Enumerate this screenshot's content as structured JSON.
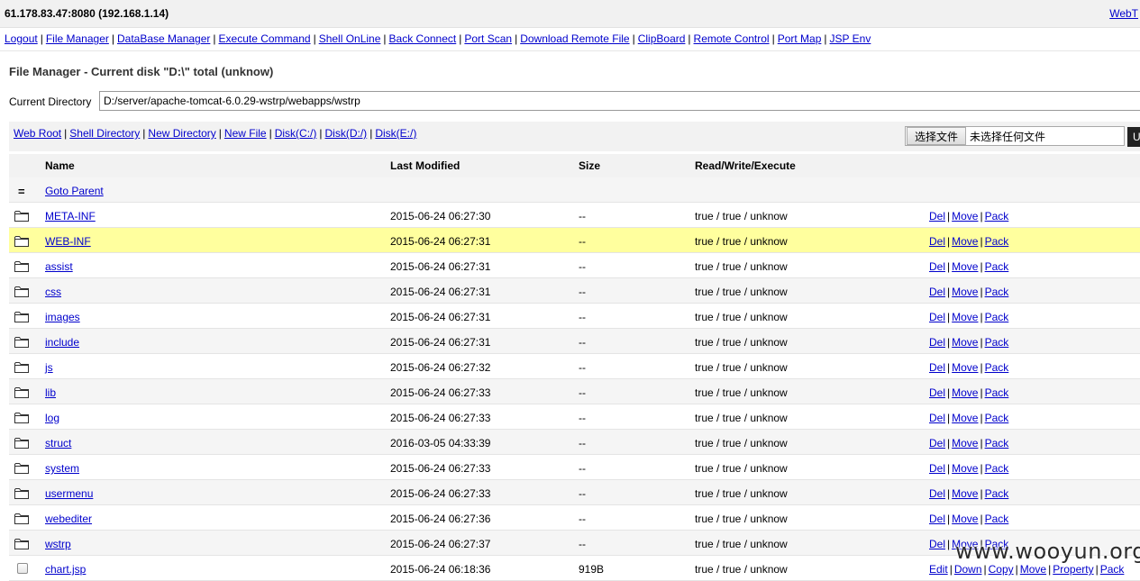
{
  "topbar": {
    "host": "61.178.83.47:8080 (192.168.1.14)",
    "brand": "WebT"
  },
  "menu": [
    "Logout",
    "File Manager",
    "DataBase Manager",
    "Execute Command",
    "Shell OnLine",
    "Back Connect",
    "Port Scan",
    "Download Remote File",
    "ClipBoard",
    "Remote Control",
    "Port Map",
    "JSP Env"
  ],
  "page_title": "File Manager - Current disk \"D:\\\" total (unknow)",
  "current_dir": {
    "label": "Current Directory",
    "value": "D:/server/apache-tomcat-6.0.29-wstrp/webapps/wstrp"
  },
  "actions": [
    "Web Root",
    "Shell Directory",
    "New Directory",
    "New File",
    "Disk(C:/)",
    "Disk(D:/)",
    "Disk(E:/)"
  ],
  "upload": {
    "choose_label": "选择文件",
    "status": "未选择任何文件",
    "button_label": "U"
  },
  "table": {
    "headers": [
      "Name",
      "Last Modified",
      "Size",
      "Read/Write/Execute"
    ],
    "parent": {
      "icon": "=",
      "label": "Goto Parent"
    },
    "dir_ops": [
      "Del",
      "Move",
      "Pack"
    ],
    "file_ops": [
      "Edit",
      "Down",
      "Copy",
      "Move",
      "Property",
      "Pack"
    ],
    "rows": [
      {
        "kind": "dir",
        "name": "META-INF",
        "modified": "2015-06-24 06:27:30",
        "size": "--",
        "rwx": "true / true / unknow"
      },
      {
        "kind": "dir",
        "name": "WEB-INF",
        "modified": "2015-06-24 06:27:31",
        "size": "--",
        "rwx": "true / true / unknow"
      },
      {
        "kind": "dir",
        "name": "assist",
        "modified": "2015-06-24 06:27:31",
        "size": "--",
        "rwx": "true / true / unknow"
      },
      {
        "kind": "dir",
        "name": "css",
        "modified": "2015-06-24 06:27:31",
        "size": "--",
        "rwx": "true / true / unknow"
      },
      {
        "kind": "dir",
        "name": "images",
        "modified": "2015-06-24 06:27:31",
        "size": "--",
        "rwx": "true / true / unknow"
      },
      {
        "kind": "dir",
        "name": "include",
        "modified": "2015-06-24 06:27:31",
        "size": "--",
        "rwx": "true / true / unknow"
      },
      {
        "kind": "dir",
        "name": "js",
        "modified": "2015-06-24 06:27:32",
        "size": "--",
        "rwx": "true / true / unknow"
      },
      {
        "kind": "dir",
        "name": "lib",
        "modified": "2015-06-24 06:27:33",
        "size": "--",
        "rwx": "true / true / unknow"
      },
      {
        "kind": "dir",
        "name": "log",
        "modified": "2015-06-24 06:27:33",
        "size": "--",
        "rwx": "true / true / unknow"
      },
      {
        "kind": "dir",
        "name": "struct",
        "modified": "2016-03-05 04:33:39",
        "size": "--",
        "rwx": "true / true / unknow"
      },
      {
        "kind": "dir",
        "name": "system",
        "modified": "2015-06-24 06:27:33",
        "size": "--",
        "rwx": "true / true / unknow"
      },
      {
        "kind": "dir",
        "name": "usermenu",
        "modified": "2015-06-24 06:27:33",
        "size": "--",
        "rwx": "true / true / unknow"
      },
      {
        "kind": "dir",
        "name": "webediter",
        "modified": "2015-06-24 06:27:36",
        "size": "--",
        "rwx": "true / true / unknow"
      },
      {
        "kind": "dir",
        "name": "wstrp",
        "modified": "2015-06-24 06:27:37",
        "size": "--",
        "rwx": "true / true / unknow"
      },
      {
        "kind": "file",
        "name": "chart.jsp",
        "modified": "2015-06-24 06:18:36",
        "size": "919B",
        "rwx": "true / true / unknow"
      }
    ]
  },
  "watermark": "www.wooyun.org",
  "colors": {
    "link": "#0000cc",
    "highlight_row": "#ffff9e",
    "shaded_row": "#f5f5f5",
    "bar_bg": "#f2f2f2"
  }
}
